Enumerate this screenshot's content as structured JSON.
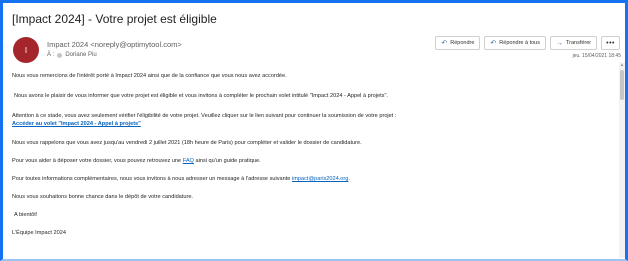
{
  "email": {
    "subject": "[Impact 2024] - Votre projet est éligible",
    "avatar_initial": "I",
    "sender": "Impact 2024 <noreply@optimytool.com>",
    "to_prefix": "À :",
    "to_name": "Doriane Piu",
    "date": "jeu. 15/04/2021 18:45"
  },
  "actions": {
    "reply": "Répondre",
    "reply_all": "Répondre à tous",
    "forward": "Transférer",
    "more": "•••"
  },
  "body": {
    "p1": "Nous vous remercions de l'intérêt porté à Impact 2024 ainsi que de la confiance que vous nous avez accordée.",
    "p2": "Nous avons le plaisir de vous informer que votre projet est éligible et vous invitons à compléter le prochain volet intitulé \"Impact 2024 - Appel à projets\".",
    "p3": "Attention à ce stade, vous avez seulement vérifier l'éligibilité de votre projet. Veuillez cliquer sur le lien suivant pour continuer la soumission de votre projet :",
    "p3_link": "Accéder au volet \"Impact 2024 - Appel à projets\"",
    "p4": "Nous vous rappelons que vous avez jusqu'au vendredi 2 juillet 2021 (18h heure de Paris) pour compléter et valider le dossier de candidature.",
    "p5_before": "Pour vous aider à déposer votre dossier, vous pouvez retrouvez une ",
    "p5_link": "FAQ",
    "p5_after": " ainsi qu'un guide pratique.",
    "p6_before": "Pour toutes informations complémentaires,  nous vous invitons à nous adresser un message à l'adresse suivante ",
    "p6_link": "impact@paris2024.org",
    "p6_after": ".",
    "p7": "Nous vous souhaitons bonne chance dans le dépôt de votre candidature.",
    "p8": "A bientôt!",
    "p9": "L'Équipe Impact 2024"
  },
  "icons": {
    "reply": "reply-arrow-icon",
    "reply_all": "reply-all-icon",
    "forward": "forward-arrow-icon"
  },
  "colors": {
    "accent": "#1573f2",
    "link": "#0563c1",
    "avatar": "#a4262c"
  }
}
